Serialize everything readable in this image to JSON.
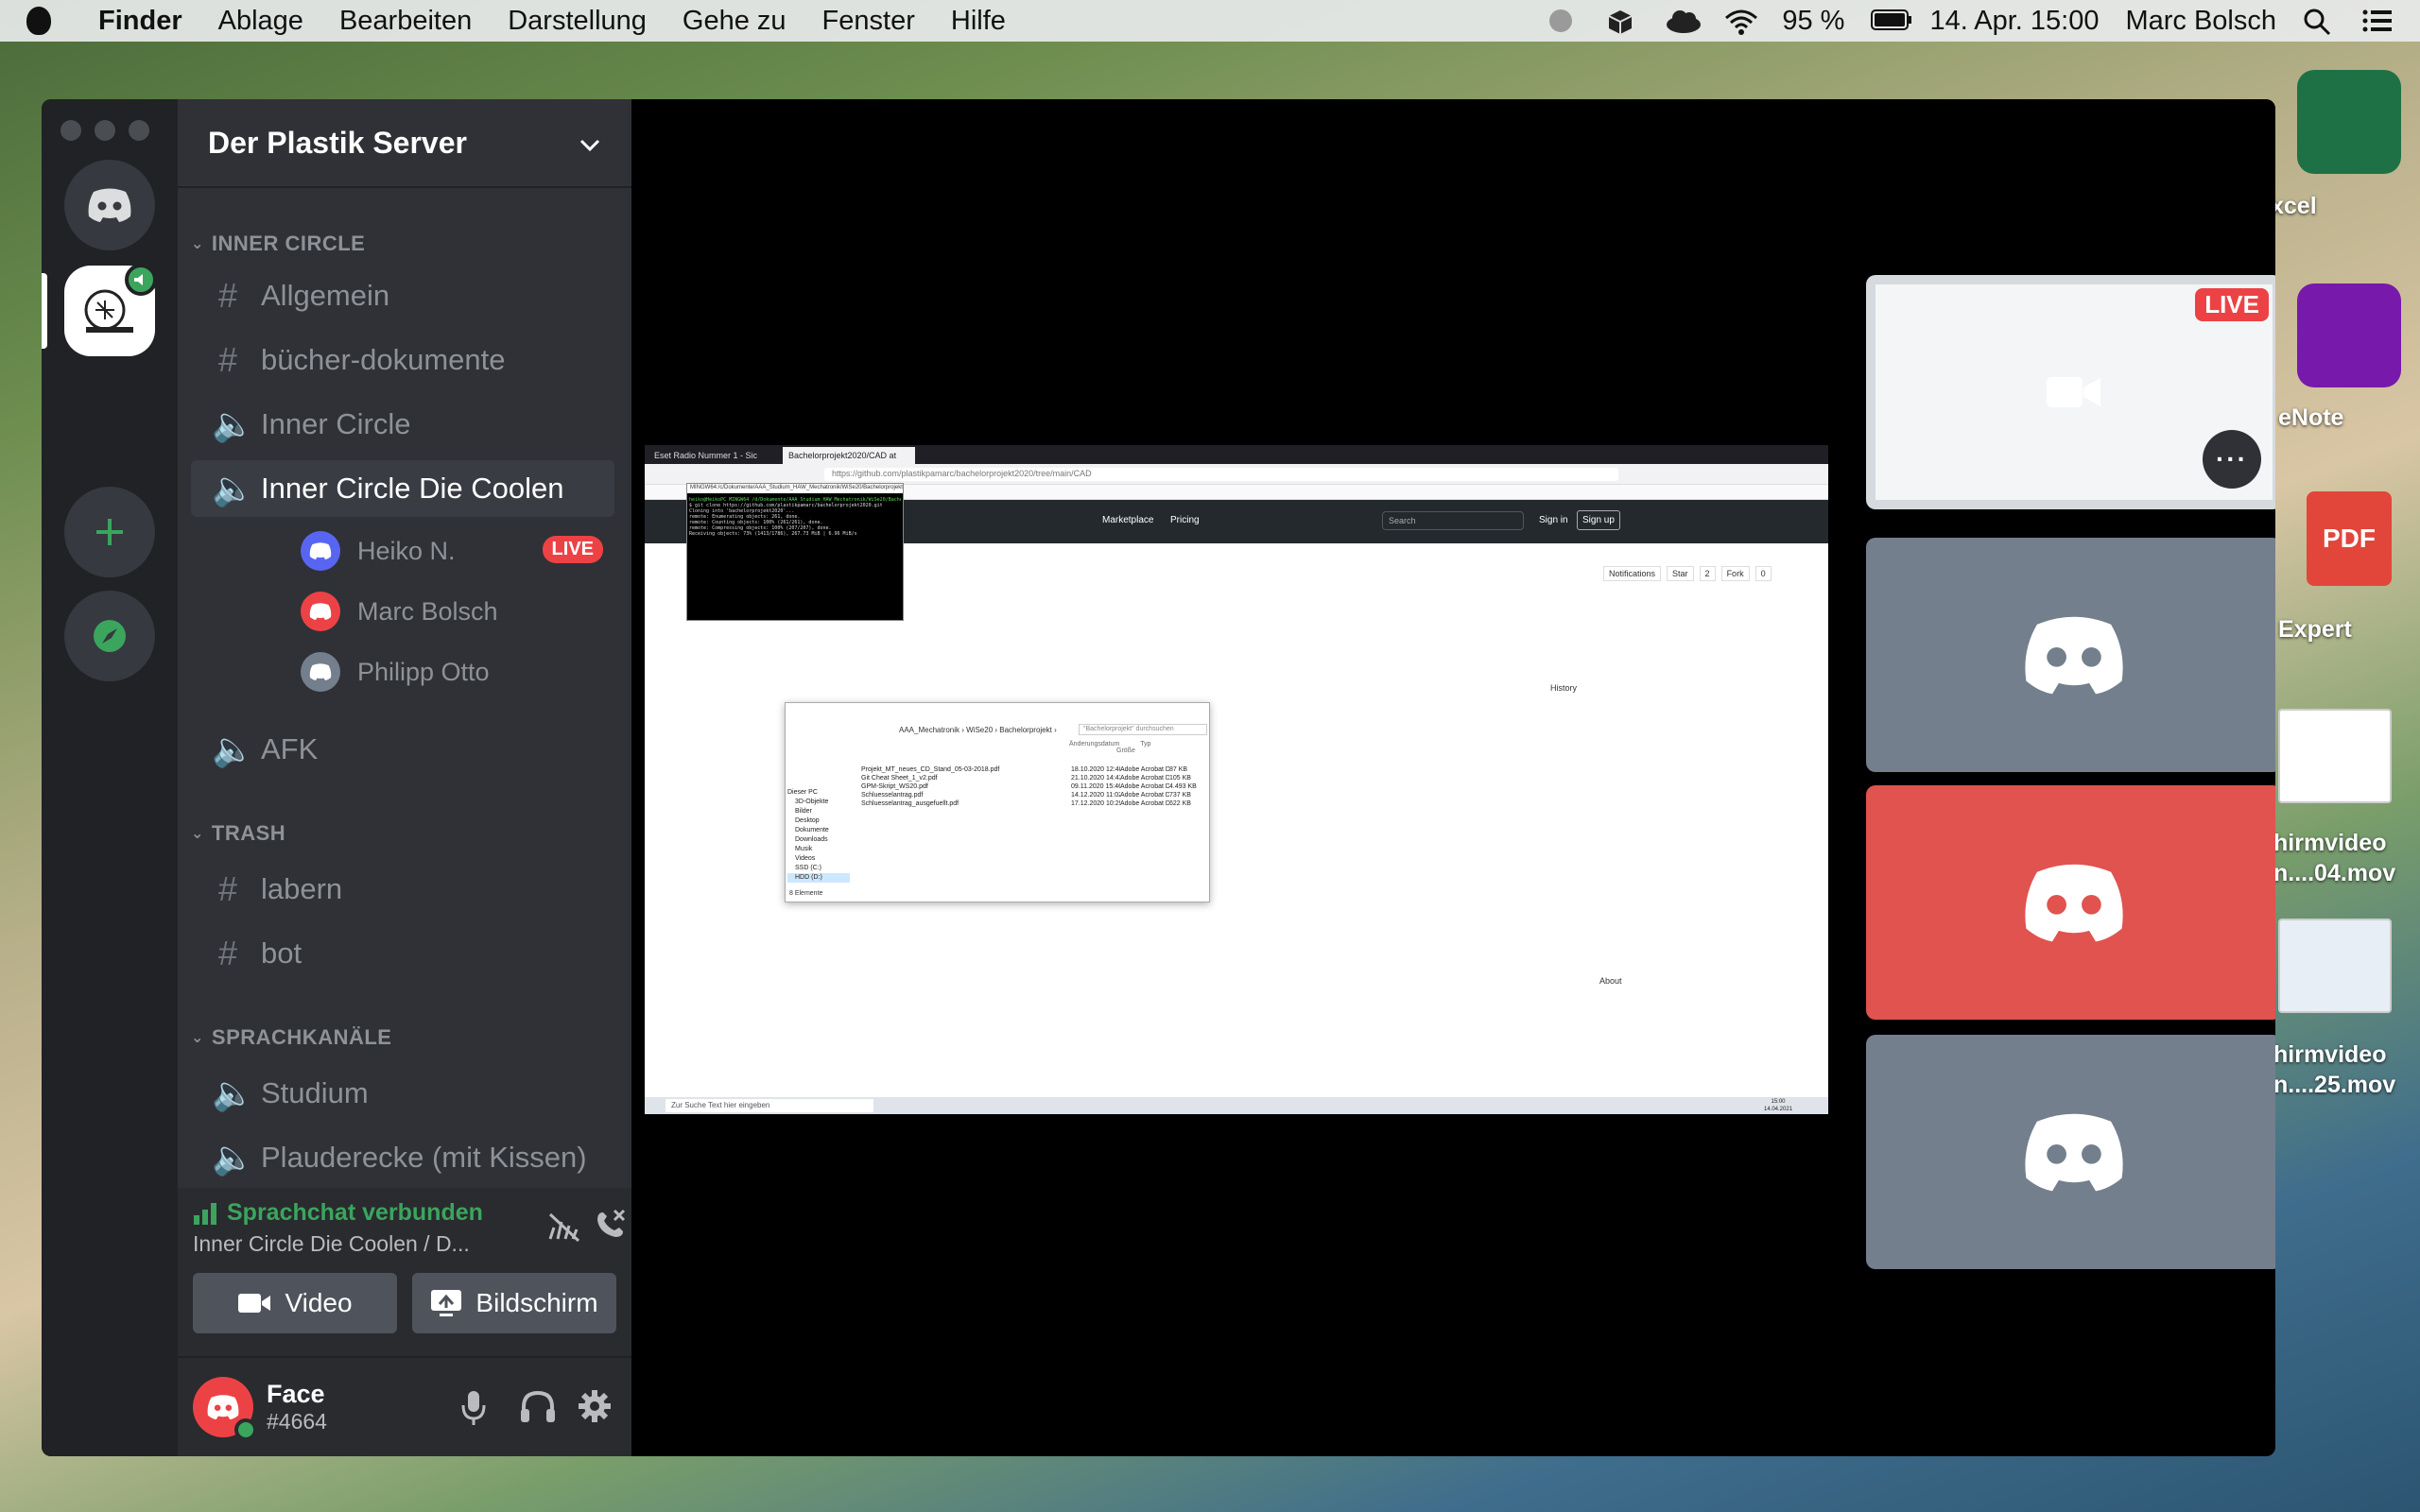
{
  "menubar": {
    "app": "Finder",
    "items": [
      "Ablage",
      "Bearbeiten",
      "Darstellung",
      "Gehe zu",
      "Fenster",
      "Hilfe"
    ],
    "battery": "95 %",
    "datetime": "14. Apr. 15:00",
    "user": "Marc Bolsch"
  },
  "desktop": {
    "labels": [
      "xcel",
      "eNote",
      "Expert",
      "hirmvideo\nn....04.mov",
      "hirmvideo\nn....25.mov"
    ],
    "pdf_badge": "PDF"
  },
  "server": {
    "name": "Der Plastik Server"
  },
  "categories": {
    "inner_circle": "INNER CIRCLE",
    "trash": "TRASH",
    "voice": "SPRACHKANÄLE"
  },
  "channels": {
    "allgemein": "Allgemein",
    "buecher": "bücher-dokumente",
    "inner_circle": "Inner Circle",
    "coolen": "Inner Circle Die Coolen",
    "afk": "AFK",
    "labern": "labern",
    "bot": "bot",
    "studium": "Studium",
    "plauderecke": "Plauderecke (mit Kissen)"
  },
  "voice_users": [
    {
      "name": "Heiko N.",
      "live": "LIVE"
    },
    {
      "name": "Marc Bolsch"
    },
    {
      "name": "Philipp Otto"
    }
  ],
  "voice_status": {
    "connected": "Sprachchat verbunden",
    "channel": "Inner Circle Die Coolen / D..."
  },
  "buttons": {
    "video": "Video",
    "screen": "Bildschirm"
  },
  "user": {
    "name": "Face",
    "tag": "#4664"
  },
  "tiles": {
    "live": "LIVE"
  },
  "screenshare": {
    "tab1": "Eset Radio Nummer 1 - Sic",
    "tab2": "Bachelorprojekt2020/CAD at",
    "url": "https://github.com/plastikpamarc/bachelorprojekt2020/tree/main/CAD",
    "terminal_title": "MINGW64:/c/Dokumente/AAA_Studium_HAW_Mechatronik/WiSe20/Bachelorprojekt",
    "terminal_lines": [
      "heiko@HeikoPC MINGW64 /d/Dokumente/AAA_Studium_HAW_Mechatronik/WiSe20/Bachelorprojekt",
      "$ git clone https://github.com/plastikpamarc/bachelorprojekt2020.git",
      "Cloning into 'bachelorprojekt2020'...",
      "remote: Enumerating objects: 261, done.",
      "remote: Counting objects: 100% (261/261), done.",
      "remote: Compressing objects: 100% (207/207), done.",
      "Receiving objects:  73% (1413/1786), 267.73 MiB | 6.96 MiB/s"
    ],
    "explorer_path": "AAA_Mechatronik › WiSe20 › Bachelorprojekt ›",
    "explorer_search": "\"Bachelorprojekt\" durchsuchen",
    "explorer_cols": [
      "Änderungsdatum",
      "Typ",
      "Größe"
    ],
    "files": [
      [
        "Projekt_MT_neues_CD_Stand_05-03-2018.pdf",
        "18.10.2020 12:40",
        "Adobe Acrobat D...",
        "87 KB"
      ],
      [
        "Git Cheat Sheet_1_v2.pdf",
        "21.10.2020 14:43",
        "Adobe Acrobat D...",
        "105 KB"
      ],
      [
        "GPM-Skript_WS20.pdf",
        "09.11.2020 15:46",
        "Adobe Acrobat D...",
        "4.493 KB"
      ],
      [
        "Schluesselantrag.pdf",
        "14.12.2020 11:02",
        "Adobe Acrobat D...",
        "737 KB"
      ],
      [
        "Schluesselantrag_ausgefuellt.pdf",
        "17.12.2020 10:29",
        "Adobe Acrobat D...",
        "622 KB"
      ]
    ],
    "sidebar": [
      "Dieser PC",
      "3D-Objekte",
      "Bilder",
      "Desktop",
      "Dokumente",
      "Downloads",
      "Musik",
      "Videos",
      "SSD (C:)",
      "HDD (D:)"
    ],
    "count": "8 Elemente",
    "gh_nav": [
      "Marketplace",
      "Pricing"
    ],
    "gh_search": "Search",
    "gh_signin": "Sign in",
    "gh_signup": "Sign up",
    "gh_actions": [
      "Notifications",
      "Star",
      "2",
      "Fork",
      "0"
    ],
    "gh_history": "History",
    "gh_about": "About",
    "taskbar_search": "Zur Suche Text hier eingeben",
    "taskbar_time": "15:00",
    "taskbar_date": "14.04.2021"
  }
}
